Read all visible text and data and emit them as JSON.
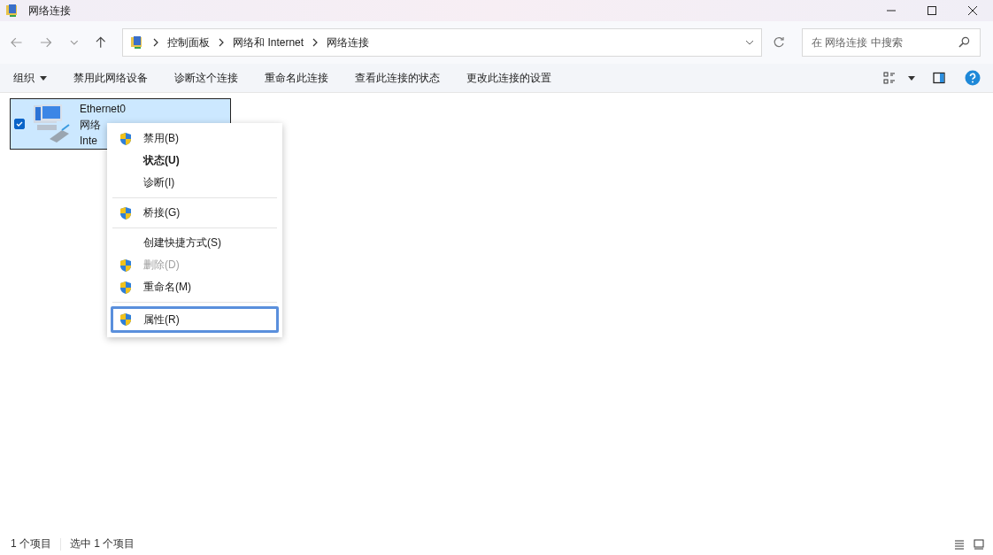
{
  "window": {
    "title": "网络连接"
  },
  "address": {
    "crumbs": [
      "控制面板",
      "网络和 Internet",
      "网络连接"
    ]
  },
  "search": {
    "placeholder": "在 网络连接 中搜索"
  },
  "toolbar": {
    "organize": "组织",
    "commands": [
      "禁用此网络设备",
      "诊断这个连接",
      "重命名此连接",
      "查看此连接的状态",
      "更改此连接的设置"
    ]
  },
  "items": [
    {
      "name": "Ethernet0",
      "line_2": "网络",
      "line_3": "Inte",
      "selected": true,
      "checked": true
    }
  ],
  "context_menu": [
    {
      "kind": "item",
      "label": "禁用(B)",
      "shield": true,
      "bold": false,
      "disabled": false,
      "selected": false
    },
    {
      "kind": "item",
      "label": "状态(U)",
      "shield": false,
      "bold": true,
      "disabled": false,
      "selected": false
    },
    {
      "kind": "item",
      "label": "诊断(I)",
      "shield": false,
      "bold": false,
      "disabled": false,
      "selected": false
    },
    {
      "kind": "separator"
    },
    {
      "kind": "item",
      "label": "桥接(G)",
      "shield": true,
      "bold": false,
      "disabled": false,
      "selected": false
    },
    {
      "kind": "separator"
    },
    {
      "kind": "item",
      "label": "创建快捷方式(S)",
      "shield": false,
      "bold": false,
      "disabled": false,
      "selected": false
    },
    {
      "kind": "item",
      "label": "删除(D)",
      "shield": true,
      "bold": false,
      "disabled": true,
      "selected": false
    },
    {
      "kind": "item",
      "label": "重命名(M)",
      "shield": true,
      "bold": false,
      "disabled": false,
      "selected": false
    },
    {
      "kind": "separator"
    },
    {
      "kind": "item",
      "label": "属性(R)",
      "shield": true,
      "bold": false,
      "disabled": false,
      "selected": true
    }
  ],
  "status_bar": {
    "count": "1 个项目",
    "selection": "选中 1 个项目"
  }
}
